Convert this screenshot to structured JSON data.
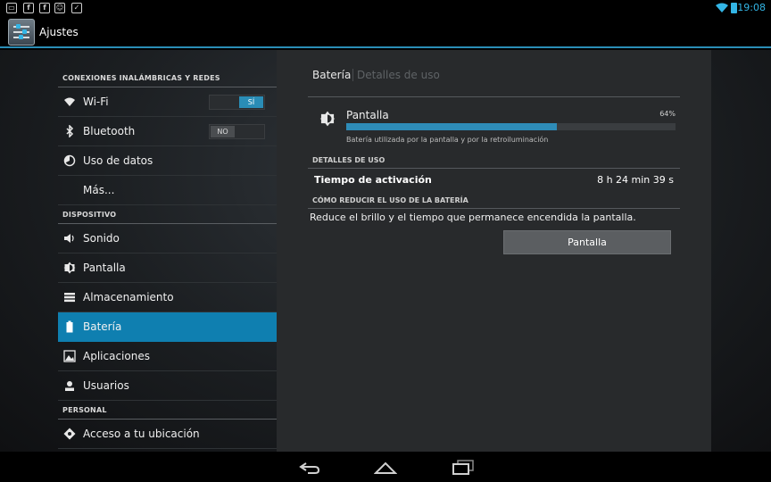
{
  "statusbar": {
    "time": "19:08",
    "notification_icons": [
      "screenshot-icon",
      "facebook-icon",
      "facebook-icon",
      "android-icon",
      "download-done-icon"
    ]
  },
  "actionbar": {
    "title": "Ajustes"
  },
  "sidebar": {
    "sections": [
      {
        "header": "CONEXIONES INALÁMBRICAS Y REDES"
      },
      {
        "header": "DISPOSITIVO"
      },
      {
        "header": "PERSONAL"
      }
    ],
    "items": [
      {
        "label": "Wi-Fi",
        "icon": "wifi-icon",
        "toggle": "SÍ",
        "toggle_state": "on"
      },
      {
        "label": "Bluetooth",
        "icon": "bluetooth-icon",
        "toggle": "NO",
        "toggle_state": "off"
      },
      {
        "label": "Uso de datos",
        "icon": "data-usage-icon"
      },
      {
        "label": "Más..."
      },
      {
        "label": "Sonido",
        "icon": "sound-icon"
      },
      {
        "label": "Pantalla",
        "icon": "brightness-icon"
      },
      {
        "label": "Almacenamiento",
        "icon": "storage-icon"
      },
      {
        "label": "Batería",
        "icon": "battery-icon",
        "active": true
      },
      {
        "label": "Aplicaciones",
        "icon": "apps-icon"
      },
      {
        "label": "Usuarios",
        "icon": "users-icon"
      },
      {
        "label": "Acceso a tu ubicación",
        "icon": "location-icon"
      }
    ]
  },
  "panel": {
    "breadcrumb": {
      "current": "Batería",
      "next": "Detalles de uso"
    },
    "app": {
      "name": "Pantalla",
      "percent_text": "64%",
      "percent": 64,
      "subtitle": "Batería utilizada por la pantalla y por la retroiluminación"
    },
    "details_header": "DETALLES DE USO",
    "details": {
      "label": "Tiempo de activación",
      "value": "8 h 24 min 39 s"
    },
    "tips_header": "CÓMO REDUCIR EL USO DE LA BATERÍA",
    "tip_text": "Reduce el brillo y el tiempo que permanece encendida la pantalla.",
    "button_label": "Pantalla"
  },
  "navbar": {
    "buttons": [
      "back-icon",
      "home-icon",
      "recents-icon"
    ]
  },
  "colors": {
    "accent": "#33b5e5",
    "active_item": "#0f7fb0",
    "progress": "#2e8cb8"
  }
}
